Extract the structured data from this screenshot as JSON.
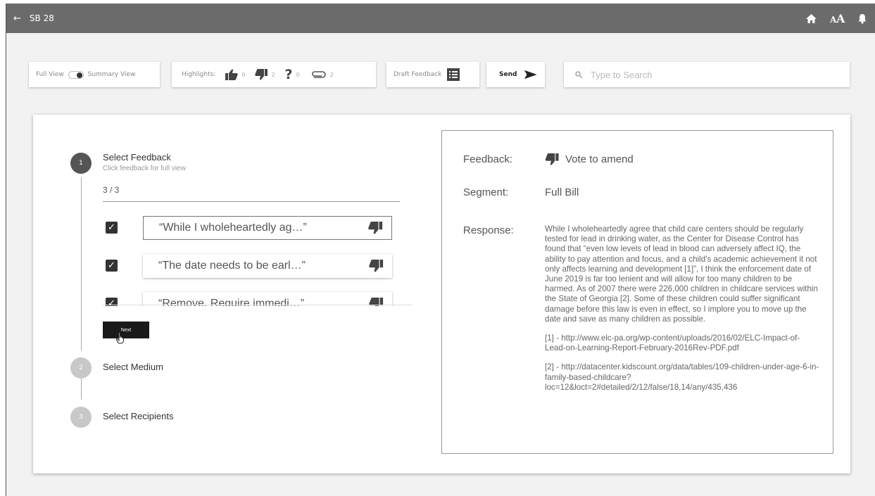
{
  "header": {
    "back_label": "←",
    "title": "SB 28"
  },
  "toolbar": {
    "full_view_label": "Full View",
    "summary_view_label": "Summary View",
    "highlights_label": "Highlights:",
    "highlights": [
      {
        "icon": "thumbs-up-icon",
        "count": "0"
      },
      {
        "icon": "thumbs-down-icon",
        "count": "2"
      },
      {
        "icon": "question-icon",
        "count": "0"
      },
      {
        "icon": "paperclip-icon",
        "count": "2"
      }
    ],
    "draft_feedback_label": "Draft Feedback",
    "send_label": "Send",
    "search_placeholder": "Type to Search"
  },
  "steps": [
    {
      "number": "1",
      "title": "Select Feedback",
      "subtitle": "Click feedback for full view"
    },
    {
      "number": "2",
      "title": "Select Medium"
    },
    {
      "number": "3",
      "title": "Select Recipients"
    }
  ],
  "feedback_count": "3 / 3",
  "feedback_items": [
    {
      "text": "“While I wholeheartedly ag…”",
      "checked": true
    },
    {
      "text": "“The date needs to be earl…”",
      "checked": true
    },
    {
      "text": "“Remove. Require immedi…”",
      "checked": true
    }
  ],
  "next_label": "Next",
  "detail": {
    "feedback_label": "Feedback:",
    "feedback_value": "Vote to amend",
    "segment_label": "Segment:",
    "segment_value": "Full Bill",
    "response_label": "Response:",
    "response_text": "While I wholeheartedly agree that child care centers should be regularly tested for lead in drinking water, as the Center for Disease Control has found that “even low levels of lead in blood can adversely affect IQ, the ability to pay attention and focus, and a child’s academic achievement it not only affects learning and development [1]”, I think the enforcement date of June 2019 is far too lenient and will allow for too many children to be harmed. As of 2007 there were 226,000 children in childcare services within the State of Georgia [2]. Some of these children could suffer significant damage before this law is even in effect, so I implore you to move up the date and save as many children as possible.",
    "ref1": "[1] - http://www.elc-pa.org/wp-content/uploads/2016/02/ELC-Impact-of-Lead-on-Learning-Report-February-2016Rev-PDF.pdf",
    "ref2": "[2] - http://datacenter.kidscount.org/data/tables/109-children-under-age-6-in-family-based-childcare?loc=12&loct=2#detailed/2/12/false/18,14/any/435,436"
  },
  "colors": {
    "topbar": "#6b6b6b",
    "active_step": "#555555",
    "inactive_step": "#c8c8c8",
    "next_button": "#1a1a1a"
  }
}
